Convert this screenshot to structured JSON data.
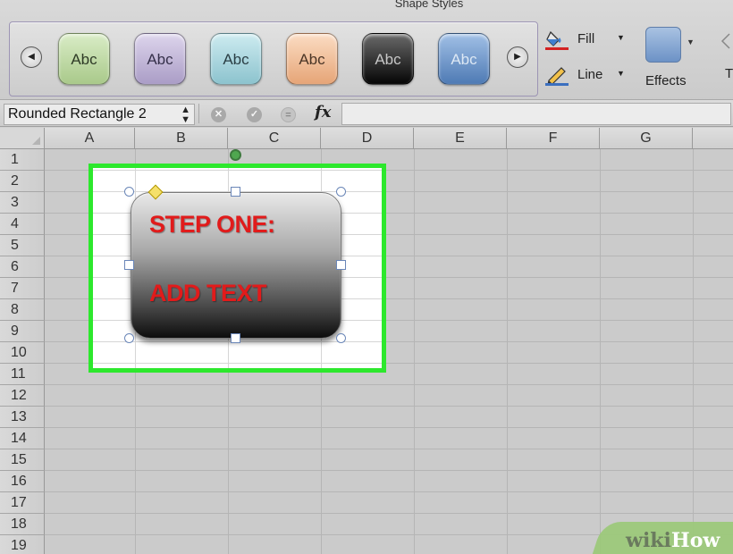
{
  "ribbon": {
    "group_title": "Shape Styles",
    "gallery_prev": "◀",
    "gallery_next": "▶",
    "styles": [
      {
        "label": "Abc",
        "fill": "#bcd6a2",
        "text_color": "#2e3a26"
      },
      {
        "label": "Abc",
        "fill": "#c3b8d8",
        "text_color": "#35304a"
      },
      {
        "label": "Abc",
        "fill": "#a9d3dc",
        "text_color": "#2a3e44"
      },
      {
        "label": "Abc",
        "fill": "#f2c39e",
        "text_color": "#4a3526"
      },
      {
        "label": "Abc",
        "fill": "#1e1e1e",
        "text_color": "#c8c8c8"
      },
      {
        "label": "Abc",
        "fill": "#6f98c8",
        "text_color": "#dde8f4"
      }
    ],
    "fill_label": "Fill",
    "line_label": "Line",
    "dropdown_caret": "▼",
    "effects_label": "Effects",
    "text_label": "T"
  },
  "formula_bar": {
    "name_box": "Rounded Rectangle 2",
    "stepper": "▲▼",
    "cancel_symbol": "✕",
    "confirm_symbol": "✓",
    "formula_symbol": "=",
    "fx_label": "fx",
    "formula_value": ""
  },
  "grid": {
    "columns": [
      "A",
      "B",
      "C",
      "D",
      "E",
      "F",
      "G"
    ],
    "rows": [
      "1",
      "2",
      "3",
      "4",
      "5",
      "6",
      "7",
      "8",
      "9",
      "10",
      "11",
      "12",
      "13",
      "14",
      "15",
      "16",
      "17",
      "18",
      "19"
    ]
  },
  "shape": {
    "line1": "STEP ONE:",
    "line2": "ADD TEXT",
    "text_color": "#e11b1b"
  },
  "watermark": {
    "part1": "wiki",
    "part2": "How"
  },
  "colors": {
    "highlight": "#2de82d",
    "selection_handle_border": "#6a86b8"
  }
}
